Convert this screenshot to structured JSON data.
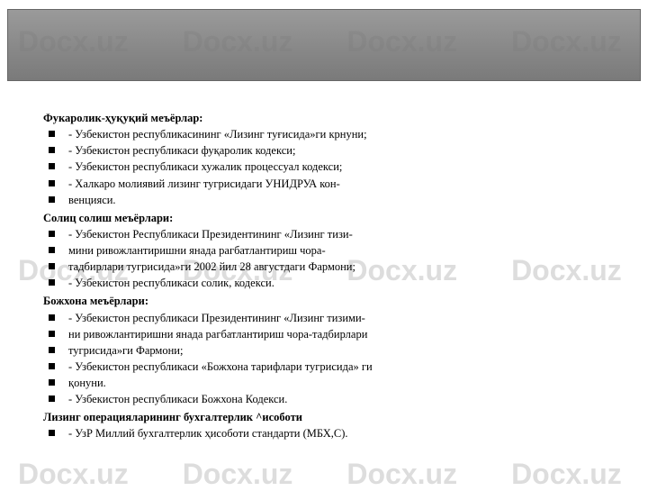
{
  "watermark": "Docx.uz",
  "sections": [
    {
      "heading": "Фукаролик-ҳуқуқий меъёрлар:",
      "items": [
        "- Узбекистон республикасининг «Лизинг туғисида»ги крнуни;",
        "- Узбекистон республикаси фуқаролик кодекси;",
        "- Узбекистон республикаси хужалик процессуал кодекси;",
        "- Халкаро молиявий лизинг тугрисидаги УНИДРУА кон-",
        "венцияси."
      ]
    },
    {
      "heading": "Солиц солиш меъёрлари:",
      "items": [
        "- Узбекистон Республикаси Президентининг «Лизинг тизи-",
        "мини ривожлантиришни янада рагбатлантириш чора-",
        "тадбирлари тугрисида»ги 2002 йил 28 августдаги Фармони;",
        "- Узбекистон республикаси солик, кодекси."
      ]
    },
    {
      "heading": "Божхона меъёрлари:",
      "items": [
        "- Узбекистон республикаси Президентининг «Лизинг тизими-",
        "ни ривожлантиришни янада рагбатлантириш чора-тадбирлари",
        "тугрисида»ги Фармони;",
        "- Узбекистон республикаси «Божхона тарифлари тугрисида» ги",
        "қонуни.",
        "- Узбекистон республикаси Божхона Кодекси."
      ]
    },
    {
      "heading": "Лизинг операцияларининг бухгалтерлик ^исоботи",
      "items": [
        "- УзР Миллий бухгалтерлик ҳисоботи стандарти (МБХ,С)."
      ]
    }
  ]
}
